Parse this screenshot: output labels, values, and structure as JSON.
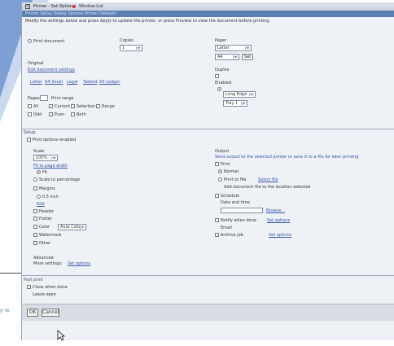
{
  "window": {
    "title": "Printer - Set Options",
    "tab": "Window List",
    "menubar": "Printer Setup Dialog Options Printer Defaults",
    "instructions": "Modify the settings below and press Apply to update the printer, or press Preview to view the document before printing."
  },
  "general": {
    "radio_label": "Print document",
    "copies_label": "Copies",
    "copies_value": "1",
    "original_label": "Original",
    "original_link": "Edit document settings",
    "size_links": [
      "Letter",
      "A4 Small",
      "Legal",
      "Tabloid",
      "A3 Ledger"
    ],
    "pages_label": "Pages",
    "pages_range": "Print range",
    "page_checks": [
      "All",
      "Current",
      "Selection",
      "Range"
    ],
    "page_checks_row2": [
      "Odd",
      "Even",
      "Both"
    ],
    "paper_label": "Paper",
    "paper_value": "Letter",
    "orientation_value": "A4",
    "orientation_btn": "Set",
    "duplex_label": "Duplex",
    "duplex_radio": "Enabled",
    "sides_value": "Long Edge",
    "tray_value": "Tray 1"
  },
  "setup": {
    "section_label": "Setup",
    "checkbox_label": "Print options enabled",
    "left": {
      "scale_label": "Scale",
      "scale_value": "100%",
      "fit_link": "Fit to page width",
      "fit_radio": "Fit",
      "scale_radio": "Scale to percentage",
      "margins_label": "Margins",
      "margin_input": "0.5 inch",
      "edit_link": "Edit",
      "header_check": "Header",
      "footer_check": "Footer",
      "color_check": "Color",
      "color_value": "Auto Color",
      "watermark_check": "Watermark",
      "extra_check": "Other",
      "advanced_label": "Advanced",
      "advanced_text": "More settings:",
      "advanced_link": "Set options"
    },
    "right": {
      "output_label": "Output",
      "output_text": "Send output to the selected printer or save it to a file for later printing",
      "print_radio": "Print",
      "normal_radio": "Normal",
      "file_radio": "Print to file",
      "file_link": "Select file",
      "file_note": "Add document file to the location selected",
      "schedule_radio": "Schedule",
      "schedule_sub": "Date and time",
      "path_input": "",
      "path_link": "Browse...",
      "notify_check": "Notify when done",
      "notify_link": "Set options",
      "notify_text": "Email",
      "archive_check": "Archive job",
      "archive_link": "Set options"
    }
  },
  "post": {
    "section_label": "Post print",
    "checkbox_label": "Close when done",
    "sub_text": "Leave open"
  },
  "footer": {
    "ok_label": "OK",
    "cancel_label": "Cancel"
  },
  "slide": {
    "side_text": "y re"
  }
}
